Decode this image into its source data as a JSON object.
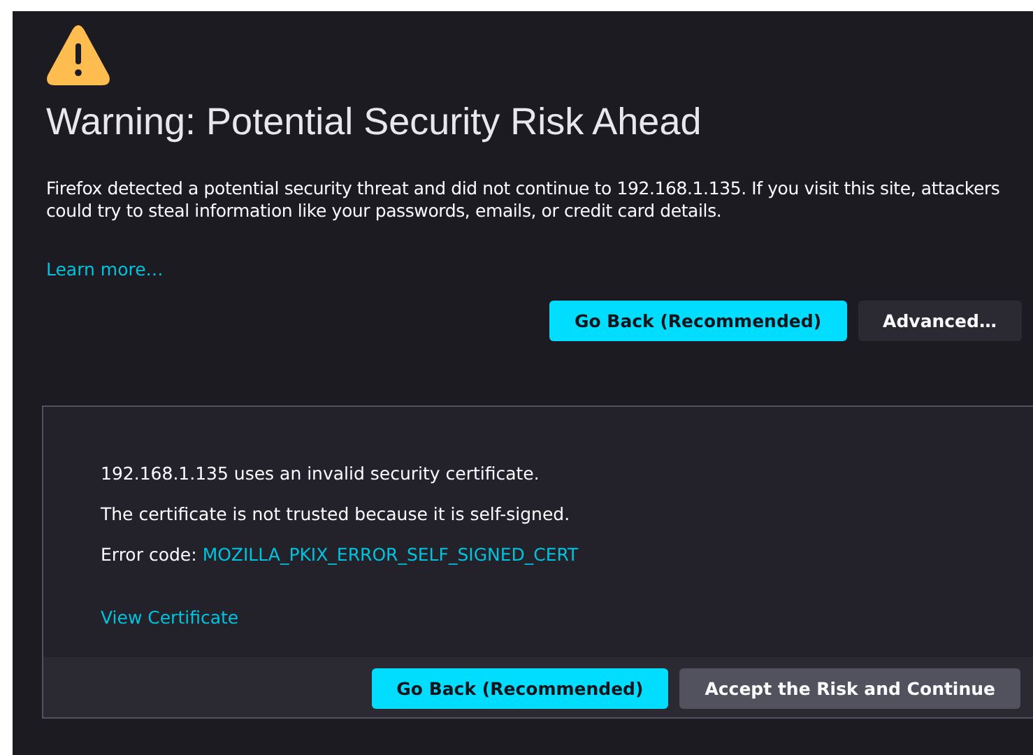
{
  "title": "Warning: Potential Security Risk Ahead",
  "description": "Firefox detected a potential security threat and did not continue to 192.168.1.135. If you visit this site, attackers could try to steal information like your passwords, emails, or credit card details.",
  "learn_more": "Learn more…",
  "buttons": [
    {
      "label": "Go Back (Recommended)",
      "kind": "primary"
    },
    {
      "label": "Advanced…",
      "kind": "secondary"
    }
  ],
  "advanced": {
    "lines": [
      "192.168.1.135 uses an invalid security certificate.",
      "The certificate is not trusted because it is self-signed."
    ],
    "error_label": "Error code:",
    "error_code": "MOZILLA_PKIX_ERROR_SELF_SIGNED_CERT",
    "view_certificate": "View Certificate",
    "buttons": [
      {
        "label": "Go Back (Recommended)",
        "kind": "primary"
      },
      {
        "label": "Accept the Risk and Continue",
        "kind": "secondary"
      }
    ]
  }
}
